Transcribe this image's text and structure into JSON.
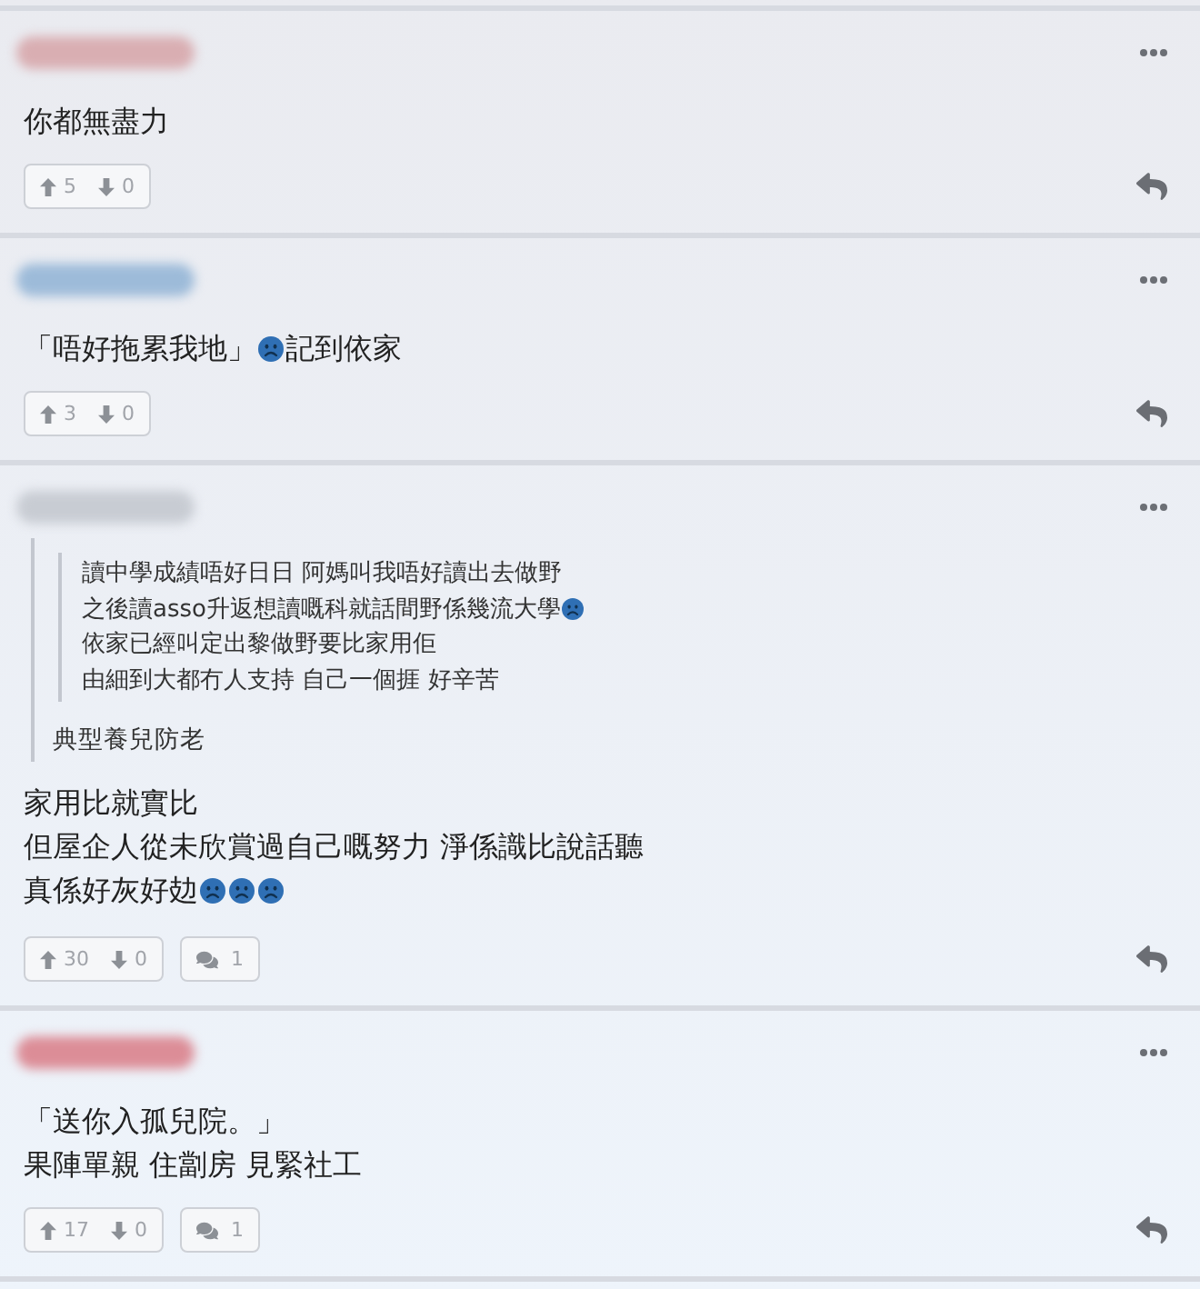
{
  "comments": [
    {
      "author": {
        "color": "#d9aeb2"
      },
      "body": [
        [
          {
            "kind": "text",
            "text": "你都無盡力"
          }
        ]
      ],
      "votes": {
        "up": "5",
        "down": "0"
      }
    },
    {
      "author": {
        "color": "#9dbbd9"
      },
      "body": [
        [
          {
            "kind": "text",
            "text": "「唔好拖累我地」"
          },
          {
            "kind": "sad_face"
          },
          {
            "kind": "text",
            "text": "記到依家"
          }
        ]
      ],
      "votes": {
        "up": "3",
        "down": "0"
      }
    },
    {
      "author": {
        "color": "#c8ccd3"
      },
      "quote": {
        "quote": {
          "body": [
            [
              {
                "kind": "text",
                "text": "讀中學成績唔好日日 阿媽叫我唔好讀出去做野"
              }
            ],
            [
              {
                "kind": "text",
                "text": "之後讀asso升返想讀嘅科就話間野係幾流大學"
              },
              {
                "kind": "sad_face"
              }
            ],
            [
              {
                "kind": "text",
                "text": "依家已經叫定出黎做野要比家用佢"
              }
            ],
            [
              {
                "kind": "text",
                "text": "由細到大都冇人支持 自己一個捱 好辛苦"
              }
            ]
          ]
        },
        "body": [
          [
            {
              "kind": "text",
              "text": "典型養兒防老"
            }
          ]
        ]
      },
      "body": [
        [
          {
            "kind": "text",
            "text": "家用比就實比"
          }
        ],
        [
          {
            "kind": "text",
            "text": "但屋企人從未欣賞過自己嘅努力 淨係識比說話聽"
          }
        ],
        [
          {
            "kind": "text",
            "text": "真係好灰好攰"
          },
          {
            "kind": "sad_face"
          },
          {
            "kind": "sad_face"
          },
          {
            "kind": "sad_face"
          }
        ]
      ],
      "votes": {
        "up": "30",
        "down": "0"
      },
      "replies": "1"
    },
    {
      "author": {
        "color": "#dc8d97"
      },
      "body": [
        [
          {
            "kind": "text",
            "text": "「送你入孤兒院。」"
          }
        ],
        [
          {
            "kind": "text",
            "text": "果陣單親 住劏房 見緊社工"
          }
        ]
      ],
      "votes": {
        "up": "17",
        "down": "0"
      },
      "replies": "1"
    }
  ]
}
